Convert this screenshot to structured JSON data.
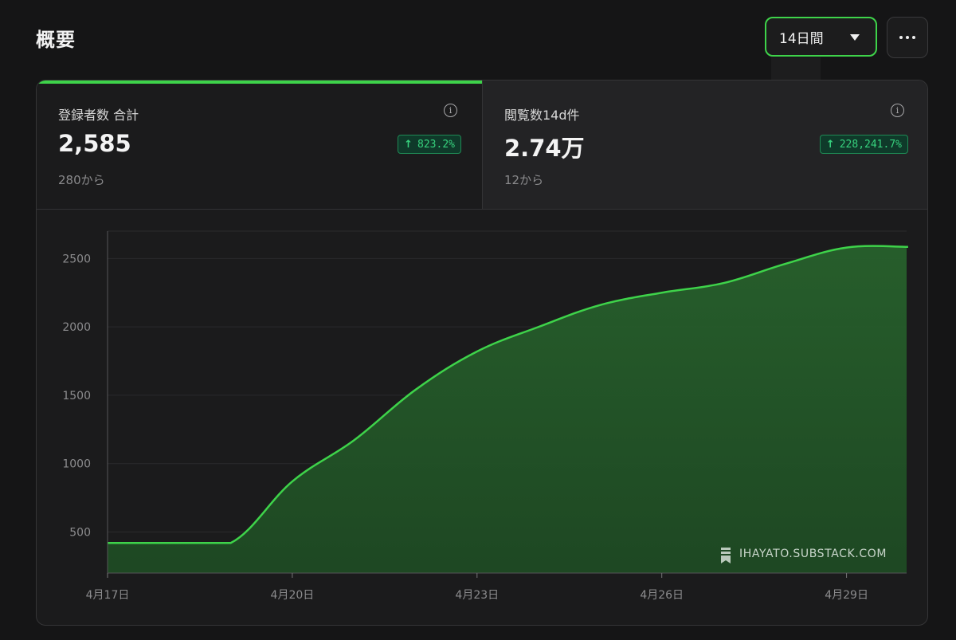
{
  "page": {
    "title": "概要"
  },
  "range": {
    "label": "14日間"
  },
  "icons": {
    "more": "more-horizontal-icon",
    "caret": "caret-down-icon",
    "info": "info-icon",
    "watermark": "substack-icon"
  },
  "colors": {
    "accent": "#3ed34a",
    "badge_text": "#37d27e",
    "area_fill": "#235a2a"
  },
  "stats": [
    {
      "label": "登録者数 合計",
      "value": "2,585",
      "change": "823.2%",
      "from": "280から",
      "active": true
    },
    {
      "label": "閲覧数14d件",
      "value": "2.74万",
      "change": "228,241.7%",
      "from": "12から",
      "active": false
    }
  ],
  "watermark": "IHAYATO.SUBSTACK.COM",
  "chart_data": {
    "type": "area",
    "x_tick_labels": [
      "4月17日",
      "4月20日",
      "4月23日",
      "4月26日",
      "4月29日"
    ],
    "y_tick_labels": [
      "500",
      "1000",
      "1500",
      "2000",
      "2500"
    ],
    "ylim": [
      200,
      2700
    ],
    "x": [
      "4月17日",
      "4月18日",
      "4月19日",
      "4月20日",
      "4月21日",
      "4月22日",
      "4月23日",
      "4月24日",
      "4月25日",
      "4月26日",
      "4月27日",
      "4月28日",
      "4月29日",
      "4月30日"
    ],
    "series": [
      {
        "values": [
          420,
          420,
          420,
          870,
          1170,
          1540,
          1820,
          2000,
          2160,
          2250,
          2320,
          2460,
          2580,
          2585
        ]
      }
    ],
    "grid": true,
    "legend": "none"
  }
}
